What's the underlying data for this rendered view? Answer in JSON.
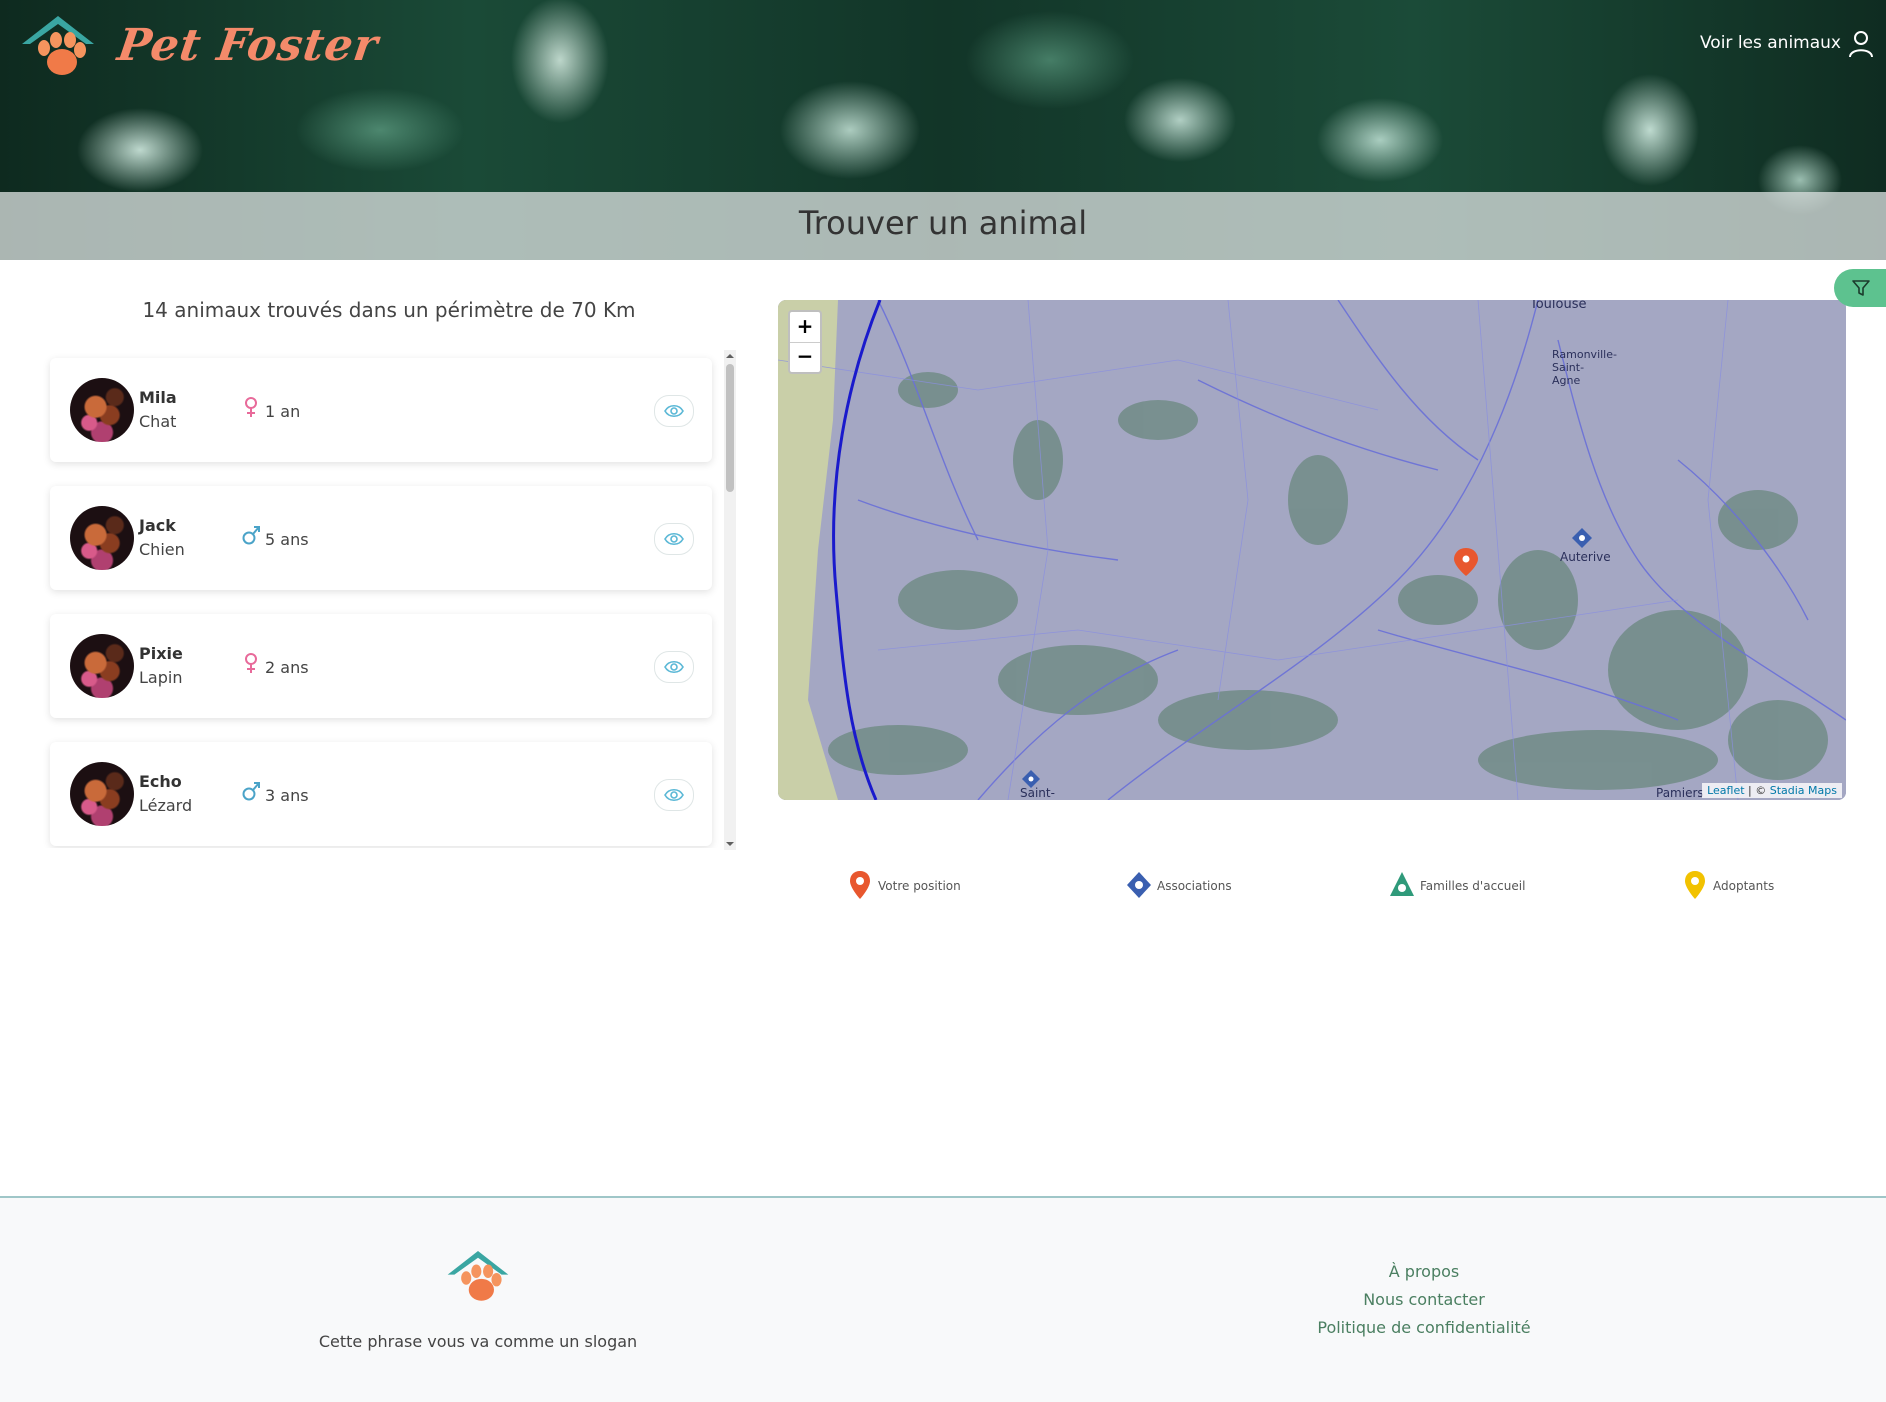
{
  "header": {
    "brand": "Pet Foster",
    "nav_link": "Voir les animaux",
    "page_title": "Trouver un animal"
  },
  "results": {
    "summary": "14 animaux trouvés dans un périmètre de 70 Km",
    "animals": [
      {
        "name": "Mila",
        "species": "Chat",
        "sex": "female",
        "age": "1 an"
      },
      {
        "name": "Jack",
        "species": "Chien",
        "sex": "male",
        "age": "5 ans"
      },
      {
        "name": "Pixie",
        "species": "Lapin",
        "sex": "female",
        "age": "2 ans"
      },
      {
        "name": "Echo",
        "species": "Lézard",
        "sex": "male",
        "age": "3 ans"
      }
    ]
  },
  "map": {
    "zoom_in": "+",
    "zoom_out": "−",
    "labels": [
      "Toulouse",
      "Ramonville-Saint-Agne",
      "Auterive",
      "Saint-",
      "Pamiers"
    ],
    "attribution_leaflet": "Leaflet",
    "attribution_sep": " | © ",
    "attribution_tiles": "Stadia Maps"
  },
  "legend": [
    {
      "label": "Votre position",
      "color": "#e8572e",
      "icon": "pin-icon"
    },
    {
      "label": "Associations",
      "color": "#3a5fb0",
      "icon": "diamond-icon"
    },
    {
      "label": "Familles d'accueil",
      "color": "#2f9a7a",
      "icon": "tree-icon"
    },
    {
      "label": "Adoptants",
      "color": "#f2c200",
      "icon": "pin-icon"
    }
  ],
  "footer": {
    "slogan": "Cette phrase vous va comme un slogan",
    "links": [
      "À propos",
      "Nous contacter",
      "Politique de confidentialité"
    ]
  },
  "colors": {
    "accent_green": "#5dc28f",
    "female": "#e86a9a",
    "male": "#4aa3c8",
    "eye": "#5bb8d6",
    "footer_link": "#4b7f61"
  }
}
